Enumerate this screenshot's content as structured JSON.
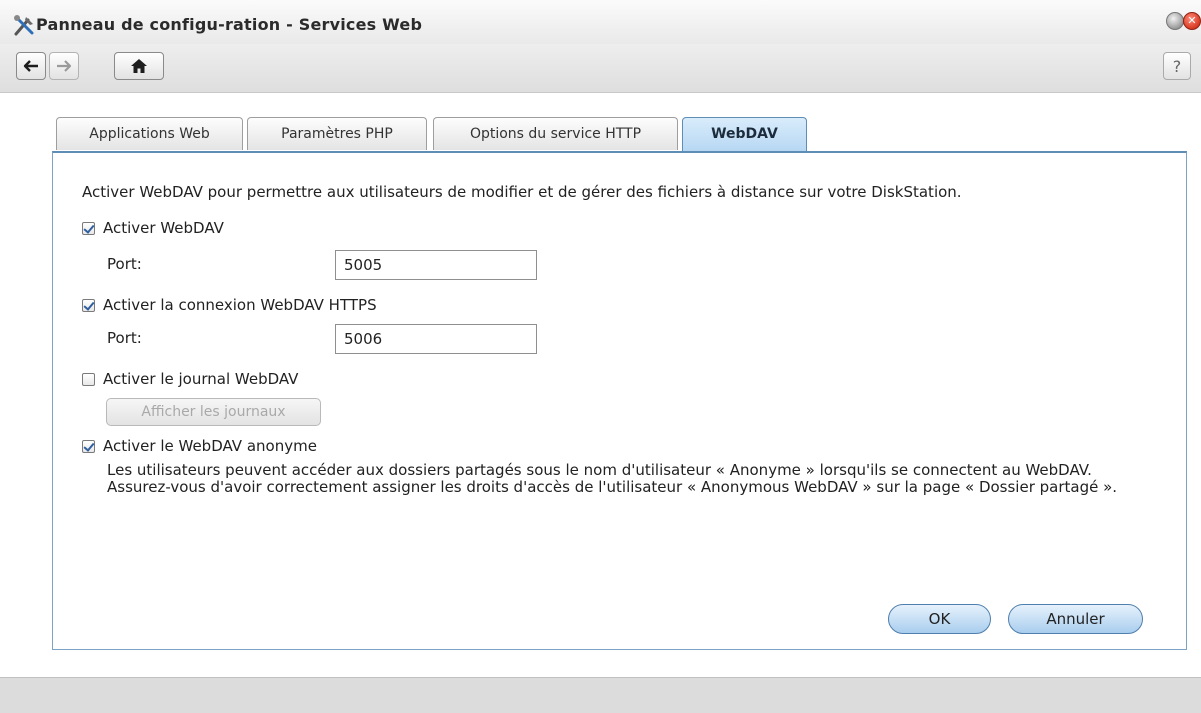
{
  "window": {
    "title": "Panneau de configu-ration - Services Web",
    "help_label": "?"
  },
  "tabs": [
    {
      "label": "Applications Web",
      "active": false
    },
    {
      "label": "Paramètres PHP",
      "active": false
    },
    {
      "label": "Options du service HTTP",
      "active": false
    },
    {
      "label": "WebDAV",
      "active": true
    }
  ],
  "webdav": {
    "description": "Activer WebDAV pour permettre aux utilisateurs de modifier et de gérer des fichiers à distance sur votre DiskStation.",
    "enable": {
      "label": "Activer WebDAV",
      "checked": true
    },
    "port_label": "Port:",
    "port_value": "5005",
    "https": {
      "label": "Activer la connexion WebDAV HTTPS",
      "checked": true
    },
    "https_port_label": "Port:",
    "https_port_value": "5006",
    "log": {
      "label": "Activer le journal WebDAV",
      "checked": false
    },
    "view_logs_label": "Afficher les journaux",
    "anonymous": {
      "label": "Activer le WebDAV anonyme",
      "checked": true
    },
    "anonymous_description": "Les utilisateurs peuvent accéder aux dossiers partagés sous le nom d'utilisateur « Anonyme » lorsqu'ils se connectent au WebDAV. Assurez-vous d'avoir correctement assigner les droits d'accès de l'utilisateur « Anonymous WebDAV » sur la page « Dossier partagé »."
  },
  "actions": {
    "ok_label": "OK",
    "cancel_label": "Annuler"
  },
  "colors": {
    "accent": "#5e8db5",
    "active_tab": "#b6d7f3",
    "button": "#a9cdee"
  }
}
